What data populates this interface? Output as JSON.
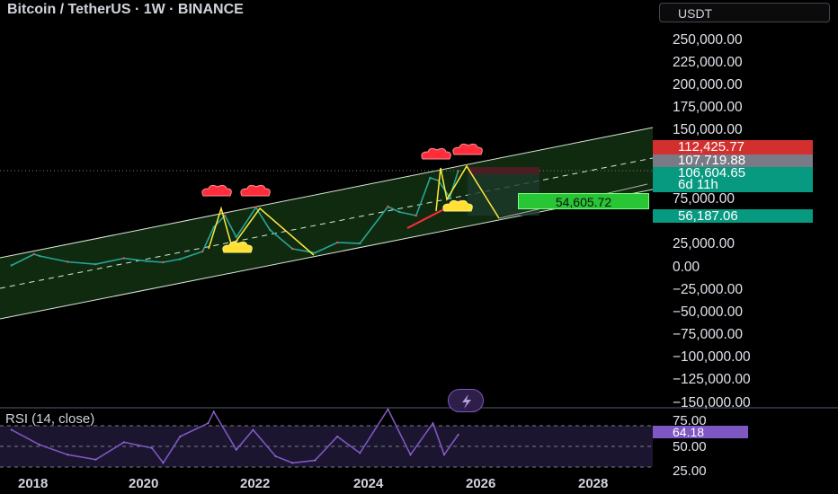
{
  "header": {
    "symbol_title": "Bitcoin / TetherUS · 1W · BINANCE",
    "currency_button": "USDT"
  },
  "indicator": {
    "label": "RSI (14, close)",
    "value_label": "64.18"
  },
  "price_axis": {
    "ticks": [
      "250,000.00",
      "225,000.00",
      "200,000.00",
      "175,000.00",
      "150,000.00",
      "75,000.00",
      "25,000.00",
      "0.00",
      "−25,000.00",
      "−50,000.00",
      "−75,000.00",
      "−100,000.00",
      "−125,000.00",
      "−150,000.00"
    ]
  },
  "rsi_axis": {
    "ticks": [
      "75.00",
      "50.00",
      "25.00"
    ]
  },
  "time_axis": {
    "ticks": [
      "2018",
      "2020",
      "2022",
      "2024",
      "2026",
      "2028"
    ]
  },
  "price_labels": {
    "high": {
      "text": "112,425.77",
      "color": "#d32f2f"
    },
    "current": {
      "text": "107,719.88",
      "color": "#787b86"
    },
    "last": {
      "text": "106,604.65",
      "color": "#089981"
    },
    "countdown": {
      "text": "6d 11h",
      "color": "#089981"
    },
    "support": {
      "text": "56,187.06",
      "color": "#089981"
    }
  },
  "target_label": {
    "text": "54,605.72",
    "color": "#28c534"
  },
  "colors": {
    "background": "#000000",
    "channel_fill": "#0f2a0f",
    "channel_line": "#d9e6d9",
    "candle_green": "#26a69a",
    "candle_red": "#ef5350",
    "pattern_line": "#ffeb3b",
    "annotation_red": "#ff2d3c",
    "annotation_yellow": "#ffe033",
    "rsi_line": "#7e57c2"
  },
  "chart_data": {
    "type": "line",
    "title": "Bitcoin / TetherUS · 1W · BINANCE",
    "xlabel": "",
    "ylabel": "",
    "x_ticks": [
      "2018",
      "2020",
      "2022",
      "2024",
      "2026",
      "2028"
    ],
    "y_range": [
      -150000,
      250000
    ],
    "series": [
      {
        "x": [
          2017.5,
          2017.9,
          2018.0,
          2018.5,
          2019.0,
          2019.5,
          2019.9,
          2020.2,
          2020.5,
          2020.9,
          2021.1,
          2021.3,
          2021.5,
          2021.85,
          2022.1,
          2022.5,
          2022.9,
          2023.3,
          2023.7,
          2024.2,
          2024.4,
          2024.7,
          2024.95,
          2025.1,
          2025.3,
          2025.45
        ],
        "values": [
          2500,
          15000,
          13000,
          6500,
          3800,
          10500,
          7300,
          6000,
          9500,
          18000,
          45000,
          58000,
          34000,
          67000,
          42000,
          21000,
          16500,
          28000,
          27000,
          68000,
          62000,
          58000,
          100000,
          97000,
          78000,
          107700
        ]
      }
    ],
    "rsi": {
      "x": [
        2017.5,
        2018.0,
        2018.5,
        2019.0,
        2019.5,
        2020.0,
        2020.2,
        2020.5,
        2021.0,
        2021.1,
        2021.5,
        2021.8,
        2022.2,
        2022.5,
        2022.9,
        2023.3,
        2023.7,
        2024.2,
        2024.6,
        2025.0,
        2025.2,
        2025.45
      ],
      "values": [
        70,
        52,
        40,
        34,
        55,
        48,
        30,
        62,
        78,
        92,
        46,
        70,
        38,
        30,
        33,
        62,
        42,
        95,
        40,
        78,
        40,
        64.18
      ]
    },
    "channel": "rising parallel channel with dashed midline"
  }
}
